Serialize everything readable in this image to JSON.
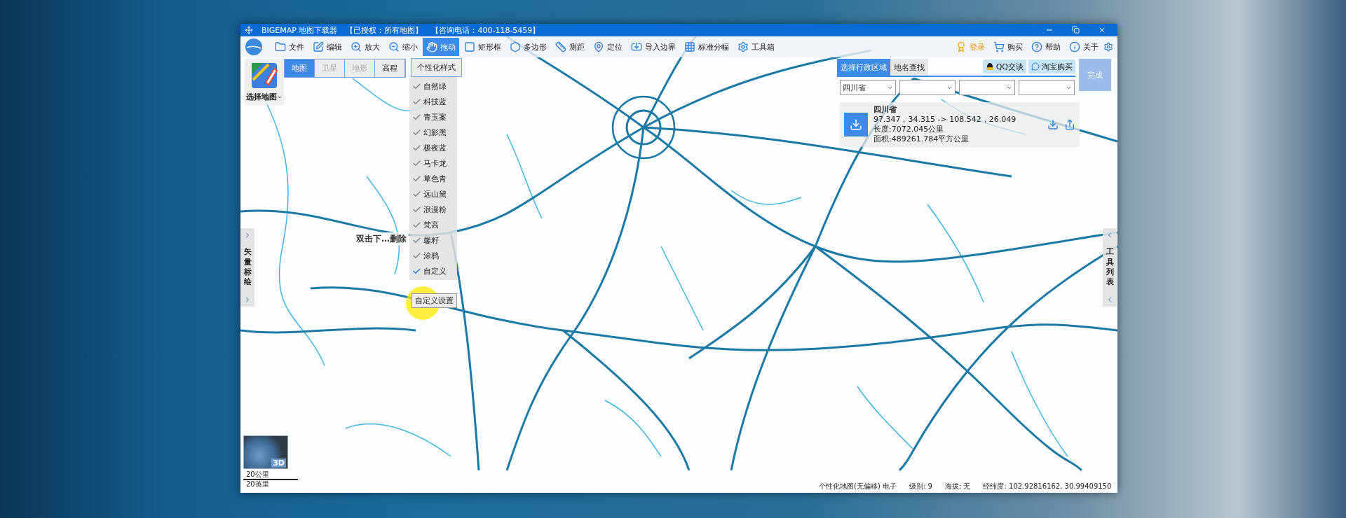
{
  "window": {
    "title_parts": [
      "BIGEMAP 地图下载器",
      "【已授权：所有地图】",
      "【咨询电话：400-118-5459】"
    ]
  },
  "toolbar": [
    {
      "label": "文件",
      "selected": false
    },
    {
      "label": "编辑",
      "selected": false
    },
    {
      "label": "放大",
      "selected": false
    },
    {
      "label": "缩小",
      "selected": false
    },
    {
      "label": "拖动",
      "selected": true
    },
    {
      "label": "矩形框",
      "selected": false
    },
    {
      "label": "多边形",
      "selected": false
    },
    {
      "label": "测距",
      "selected": false
    },
    {
      "label": "定位",
      "selected": false
    },
    {
      "label": "导入边界",
      "selected": false
    },
    {
      "label": "标准分幅",
      "selected": false
    },
    {
      "label": "工具箱",
      "selected": false
    }
  ],
  "account_actions": [
    {
      "label": "登录",
      "kind": "highlight"
    },
    {
      "label": "购买",
      "kind": "plain"
    },
    {
      "label": "帮助",
      "kind": "plain"
    },
    {
      "label": "关于",
      "kind": "plain"
    }
  ],
  "map_selector": "选择地图",
  "map_types": [
    {
      "label": "地图",
      "selected": true,
      "disabled": false
    },
    {
      "label": "卫星",
      "selected": false,
      "disabled": true
    },
    {
      "label": "地形",
      "selected": false,
      "disabled": true
    },
    {
      "label": "高程",
      "selected": false,
      "disabled": false
    }
  ],
  "style_button": "个性化样式",
  "styles": [
    {
      "label": "自然绿",
      "selected": false
    },
    {
      "label": "科技蓝",
      "selected": false
    },
    {
      "label": "青玉案",
      "selected": false
    },
    {
      "label": "幻影黑",
      "selected": false
    },
    {
      "label": "极夜蓝",
      "selected": false
    },
    {
      "label": "马卡龙",
      "selected": false
    },
    {
      "label": "草色青",
      "selected": false
    },
    {
      "label": "远山黛",
      "selected": false
    },
    {
      "label": "浪漫粉",
      "selected": false
    },
    {
      "label": "梵高",
      "selected": false
    },
    {
      "label": "馨籽",
      "selected": false
    },
    {
      "label": "涂鸦",
      "selected": false
    },
    {
      "label": "自定义",
      "selected": true
    }
  ],
  "custom_settings_button": "自定义设置",
  "tooltip": "双击下…删除",
  "side_tabs": {
    "left": "矢量标绘",
    "right": "工具列表"
  },
  "region_panel": {
    "tabs": [
      {
        "label": "选择行政区域",
        "selected": true
      },
      {
        "label": "地名查找",
        "selected": false
      }
    ],
    "links": [
      "QQ交谈",
      "淘宝购买"
    ],
    "done_button": "完成",
    "selects": [
      {
        "kind": "filled",
        "value": "四川省"
      },
      {
        "kind": "empty"
      },
      {
        "kind": "empty"
      },
      {
        "kind": "empty"
      }
    ],
    "info": {
      "name": "四川省",
      "bounds": "97.347，34.315 -> 108.542，26.049",
      "length": "长度:7072.045公里",
      "area": "面积:489261.784平方公里"
    }
  },
  "globe_label": "3D",
  "scale": {
    "metric": "20公里",
    "imperial": "20英里"
  },
  "status_bar": {
    "map": "个性化地图(无偏移) 电子",
    "level": "级别: 9",
    "altitude": "海拔: 无",
    "coords": "经纬度: 102.92816162, 30.99409150"
  }
}
